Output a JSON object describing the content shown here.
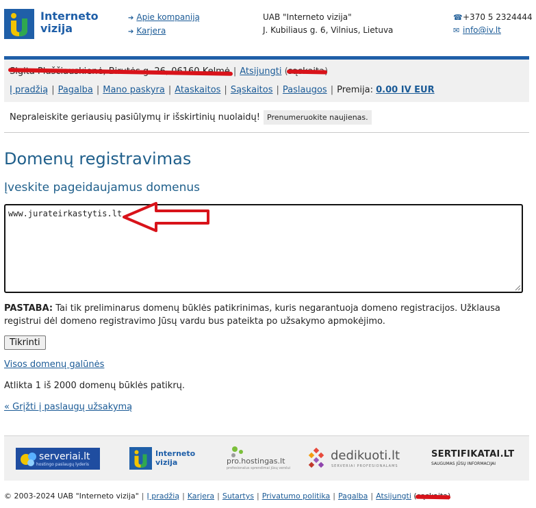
{
  "header": {
    "logo_text_line1": "Interneto",
    "logo_text_line2": "vizija",
    "links": [
      {
        "label": "Apie kompaniją"
      },
      {
        "label": "Karjera"
      }
    ],
    "company_name": "UAB \"Interneto vizija\"",
    "company_address": "J. Kubiliaus g. 6, Vilnius, Lietuva",
    "phone": "+370 5 2324444",
    "email": "info@iv.lt"
  },
  "account": {
    "user_redacted": "Sigita Pluščiauskienė, Birutės g. 26, 06160 Kelmė",
    "logout": "Atsijungti",
    "other_redacted": "sąskaita",
    "nav": [
      "Į pradžią",
      "Pagalba",
      "Mano paskyra",
      "Ataskaitos",
      "Sąskaitos",
      "Paslaugos"
    ],
    "premija_label": "Premija:",
    "premija_value": "0.00 IV EUR"
  },
  "newsletter": {
    "text": "Nepraleiskite geriausių pasiūlymų ir išskirtinių nuolaidų!",
    "button": "Prenumeruokite naujienas."
  },
  "main": {
    "title": "Domenų registravimas",
    "subtitle": "Įveskite pageidaujamus domenus",
    "domain_value": "www.jurateirkastytis.lt",
    "note_label": "PASTABA:",
    "note_text": "Tai tik preliminarus domenų būklės patikrinimas, kuris negarantuoja domeno registracijos. Užklausa registrui dėl domeno registravimo Jūsų vardu bus pateikta po užsakymo apmokėjimo.",
    "check_button": "Tikrinti",
    "all_tlds_link": "Visos domenų galūnės",
    "checks_info": "Atlikta 1 iš 2000 domenų būklės patikrų.",
    "back_link": "« Grįžti į paslaugų užsakymą"
  },
  "partners": [
    {
      "name": "serveriai.lt",
      "tagline": "hostingo paslaugų lyderis"
    },
    {
      "name_line1": "Interneto",
      "name_line2": "vizija"
    },
    {
      "name": "pro.hostingas.lt",
      "tagline": "profesionalus sprendimai jūsų verslui"
    },
    {
      "name": "dedikuoti.lt",
      "tagline": "SERVERIAI PROFESIONALAMS"
    },
    {
      "name": "SERTIFIKATAI.LT",
      "tagline": "SAUGUMAS JŪSŲ INFORMACIJAI"
    }
  ],
  "footer": {
    "copyright": "© 2003-2024 UAB \"Interneto vizija\"",
    "links": [
      "Į pradžią",
      "Karjera",
      "Sutartys",
      "Privatumo politika",
      "Pagalba",
      "Atsijungti"
    ],
    "redacted": "sąskaita"
  },
  "colors": {
    "brand_blue": "#1f5fa8",
    "heading_blue": "#1f5f8b",
    "link_blue": "#1a5a96",
    "annotation_red": "#d8131a",
    "logo_yellow": "#f2c400"
  },
  "icons": [
    "phone-icon",
    "email-icon",
    "arrow-icon",
    "red-callout-arrow-icon"
  ]
}
